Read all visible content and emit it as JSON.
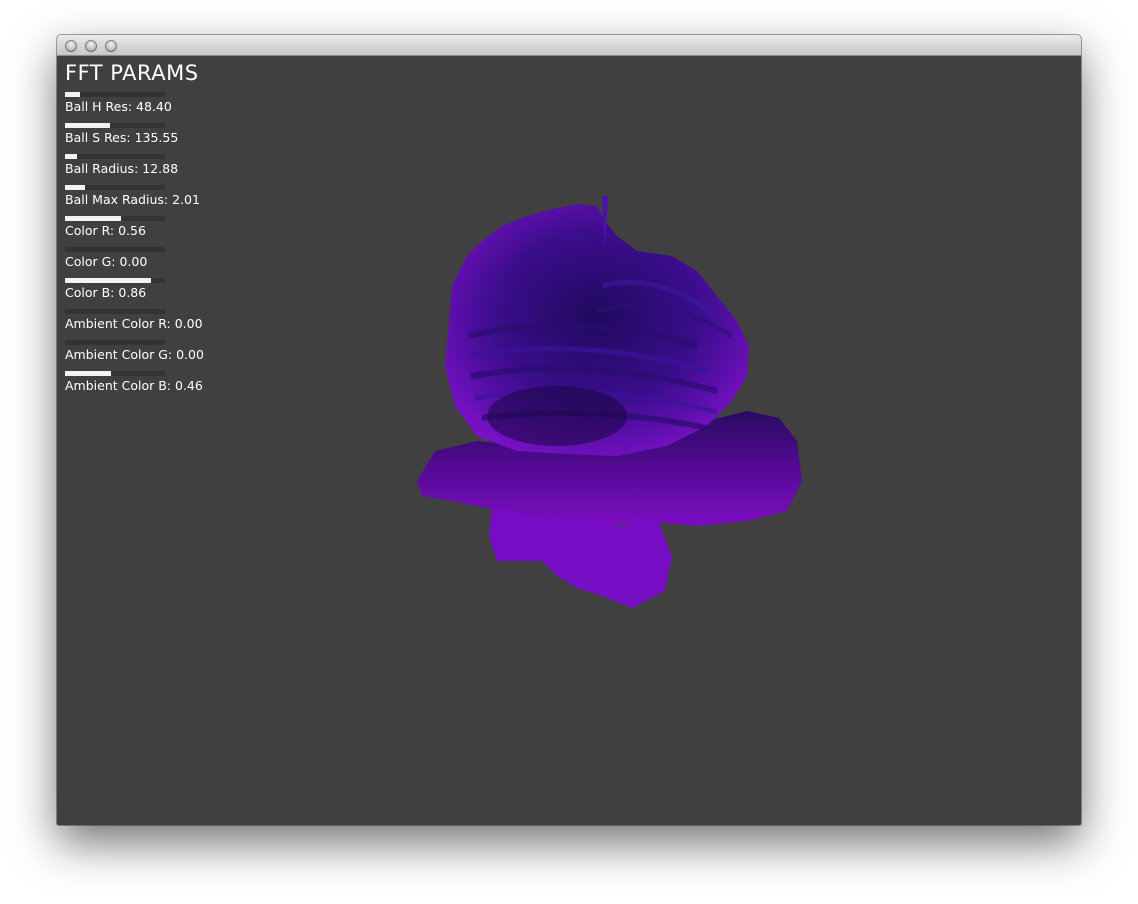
{
  "window": {
    "buttons": [
      "close",
      "minimize",
      "maximize"
    ]
  },
  "gui": {
    "title": "FFT PARAMS",
    "sliders": [
      {
        "label": "Ball H Res: 48.40",
        "value": 0.15
      },
      {
        "label": "Ball S Res: 135.55",
        "value": 0.45
      },
      {
        "label": "Ball Radius: 12.88",
        "value": 0.12
      },
      {
        "label": "Ball Max Radius: 2.01",
        "value": 0.2
      },
      {
        "label": "Color R: 0.56",
        "value": 0.56
      },
      {
        "label": "Color G: 0.00",
        "value": 0.0
      },
      {
        "label": "Color B: 0.86",
        "value": 0.86
      },
      {
        "label": "Ambient Color R: 0.00",
        "value": 0.0
      },
      {
        "label": "Ambient Color G: 0.00",
        "value": 0.0
      },
      {
        "label": "Ambient Color B: 0.46",
        "value": 0.46
      }
    ]
  },
  "colors": {
    "background": "#404040",
    "slider_track": "#333333",
    "slider_fill": "#f2f2f2",
    "object_primary": "#7a10c8",
    "object_dark": "#2a0a70"
  }
}
